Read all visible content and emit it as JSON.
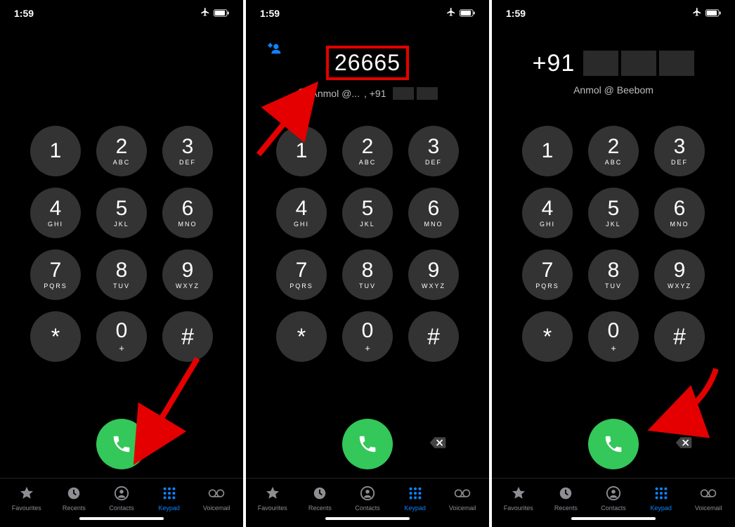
{
  "status": {
    "time": "1:59"
  },
  "screens": [
    {
      "number": "",
      "suggestion": null,
      "showDelete": false,
      "showAddContact": false
    },
    {
      "number": "26665",
      "suggestion": {
        "name": "Anmol @...",
        "tail": ", +91"
      },
      "showDelete": true,
      "showAddContact": true,
      "highlightNumber": true
    },
    {
      "number": "+91",
      "suggestion": {
        "name": "Anmol @ Beebom",
        "tail": ""
      },
      "showDelete": true,
      "showAddContact": false,
      "blurredAfter": true
    }
  ],
  "keys": [
    {
      "d": "1",
      "s": ""
    },
    {
      "d": "2",
      "s": "ABC"
    },
    {
      "d": "3",
      "s": "DEF"
    },
    {
      "d": "4",
      "s": "GHI"
    },
    {
      "d": "5",
      "s": "JKL"
    },
    {
      "d": "6",
      "s": "MNO"
    },
    {
      "d": "7",
      "s": "PQRS"
    },
    {
      "d": "8",
      "s": "TUV"
    },
    {
      "d": "9",
      "s": "WXYZ"
    },
    {
      "d": "*",
      "s": ""
    },
    {
      "d": "0",
      "s": "+"
    },
    {
      "d": "#",
      "s": ""
    }
  ],
  "tabs": [
    {
      "label": "Favourites"
    },
    {
      "label": "Recents"
    },
    {
      "label": "Contacts"
    },
    {
      "label": "Keypad"
    },
    {
      "label": "Voicemail"
    }
  ],
  "activeTabIndex": 3
}
